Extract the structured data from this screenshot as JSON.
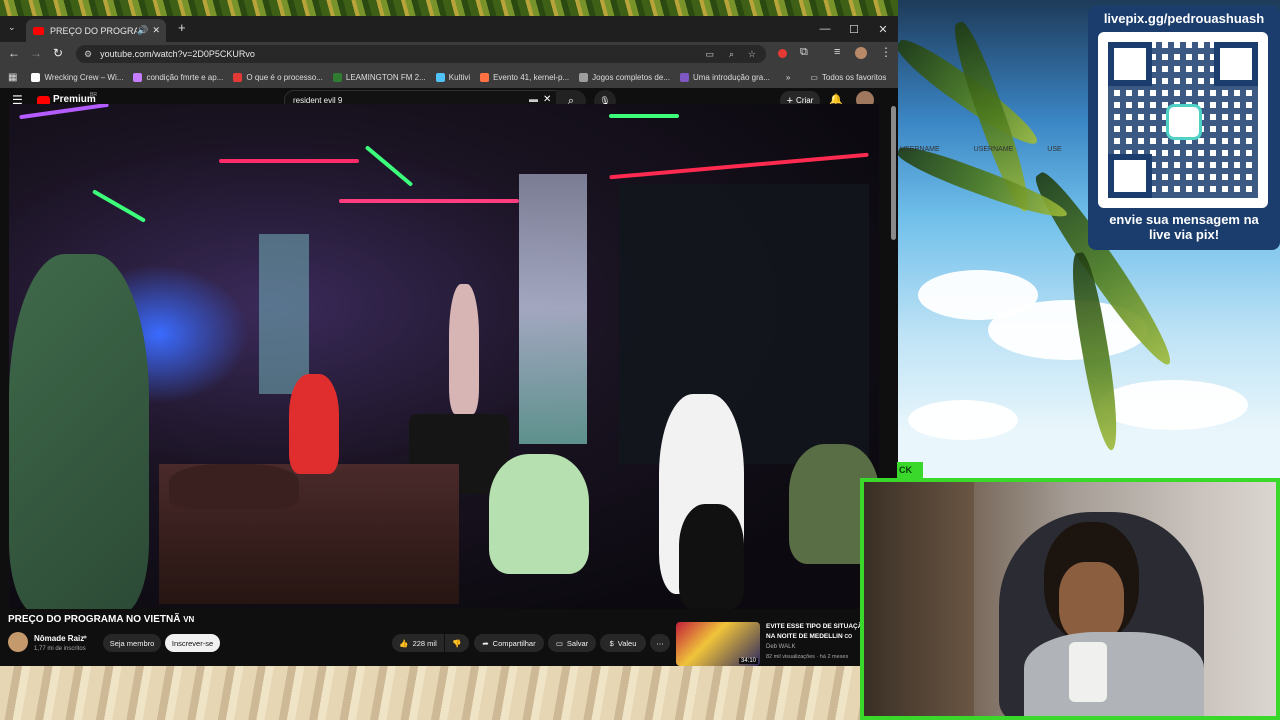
{
  "browser": {
    "tab_title": "PREÇO DO PROGRAMA NO",
    "url": "youtube.com/watch?v=2D0P5CKURvo",
    "bookmarks": [
      {
        "label": "Wrecking Crew – Wi...",
        "color": "#ffffff"
      },
      {
        "label": "condição fmrte e ap...",
        "color": "#c77dff"
      },
      {
        "label": "O que é o processo...",
        "color": "#e53935"
      },
      {
        "label": "LEAMINGTON FM 2...",
        "color": "#2e7d32"
      },
      {
        "label": "Kultivi",
        "color": "#4fc3f7"
      },
      {
        "label": "Evento 41, kernel-p...",
        "color": "#ff7043"
      },
      {
        "label": "Jogos completos de...",
        "color": "#9e9e9e"
      },
      {
        "label": "Uma introdução gra...",
        "color": "#7e57c2"
      }
    ],
    "all_favorites": "Todos os favoritos"
  },
  "youtube": {
    "logo": "Premium",
    "logo_badge": "BR",
    "search_value": "resident evil 9",
    "create_label": "Criar",
    "video_title": "PREÇO DO PROGRAMA NO VIETNÃ",
    "video_title_suffix": "VN",
    "channel_name": "Nômade Raiz",
    "subscribers": "1,77 mi de inscritos",
    "join_label": "Seja membro",
    "subscribe_label": "Inscrever-se",
    "likes": "228 mil",
    "share_label": "Compartilhar",
    "save_label": "Salvar",
    "thanks_label": "Valeu",
    "rec_title_line1": "EVITE ESSE TIPO DE SITUAÇÃO",
    "rec_title_line2": "NA NOITE DE MEDELLIN",
    "rec_country": "CO",
    "rec_channel": "Deb WALK",
    "rec_stats": "82 mil visualizações · há 2 meses",
    "rec_duration": "34:10"
  },
  "overlay": {
    "pix_url": "livepix.gg/pedrouashuash",
    "pix_msg_line1": "envie sua mensagem na",
    "pix_msg_line2": "live via pix!",
    "usernames": [
      "USERNAME",
      "USERNAME",
      "USE"
    ],
    "webcam_tag": "CK"
  },
  "colors": {
    "accent_green": "#39d82a",
    "yt_red": "#ff0000",
    "pix_blue": "#1a3d6e"
  }
}
